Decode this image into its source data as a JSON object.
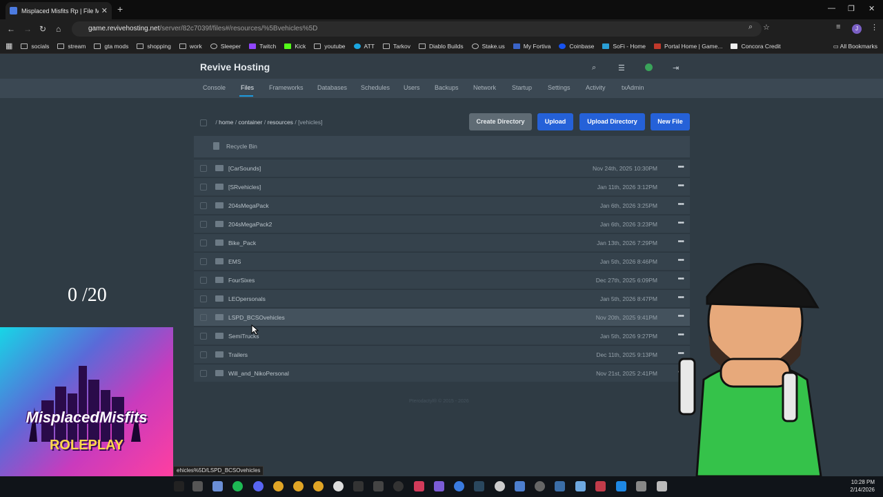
{
  "browser": {
    "tab_title": "Misplaced Misfits Rp | File Man...",
    "url_domain": "game.revivehosting.net",
    "url_path": "/server/82c7039f/files#/resources/%5Bvehicles%5D",
    "avatar_letter": "J",
    "bookmarks": [
      "socials",
      "stream",
      "gta mods",
      "shopping",
      "work",
      "Sleeper",
      "Twitch",
      "Kick",
      "youtube",
      "ATT",
      "Tarkov",
      "Diablo Builds",
      "Stake.us",
      "My Fortiva",
      "Coinbase",
      "SoFi - Home",
      "Portal Home | Game...",
      "Concora Credit"
    ],
    "all_bookmarks": "All Bookmarks"
  },
  "panel": {
    "brand": "Revive Hosting",
    "nav": [
      "Console",
      "Files",
      "Frameworks",
      "Databases",
      "Schedules",
      "Users",
      "Backups",
      "Network",
      "Startup",
      "Settings",
      "Activity",
      "txAdmin"
    ],
    "active_nav": "Files",
    "breadcrumb": {
      "sep": "/",
      "parts": [
        "home",
        "container",
        "resources"
      ],
      "current": "[vehicles]"
    },
    "buttons": {
      "create_directory": "Create Directory",
      "upload": "Upload",
      "upload_directory": "Upload Directory",
      "new_file": "New File"
    },
    "recycle_bin": "Recycle Bin",
    "files": [
      {
        "name": "[CarSounds]",
        "date": "Nov 24th, 2025 10:30PM"
      },
      {
        "name": "[SRvehicles]",
        "date": "Jan 11th, 2026 3:12PM"
      },
      {
        "name": "204sMegaPack",
        "date": "Jan 6th, 2026 3:25PM"
      },
      {
        "name": "204sMegaPack2",
        "date": "Jan 6th, 2026 3:23PM"
      },
      {
        "name": "Bike_Pack",
        "date": "Jan 13th, 2026 7:29PM"
      },
      {
        "name": "EMS",
        "date": "Jan 5th, 2026 8:46PM"
      },
      {
        "name": "FourSixes",
        "date": "Dec 27th, 2025 6:09PM"
      },
      {
        "name": "LEOpersonals",
        "date": "Jan 5th, 2026 8:47PM"
      },
      {
        "name": "LSPD_BCSOvehicles",
        "date": "Nov 20th, 2025 9:41PM"
      },
      {
        "name": "SemiTrucks",
        "date": "Jan 5th, 2026 9:27PM"
      },
      {
        "name": "Trailers",
        "date": "Dec 11th, 2025 9:13PM"
      },
      {
        "name": "Will_and_NikoPersonal",
        "date": "Nov 21st, 2025 2:41PM"
      }
    ],
    "footer": "Pterodactyl® © 2015 - 2026"
  },
  "overlay": {
    "counter": "0 /20",
    "logo_line1": "MisplacedMisfits",
    "logo_line2": "ROLEPLAY",
    "status_tooltip": "ehicles%5D/LSPD_BCSOvehicles"
  },
  "taskbar": {
    "time": "10:28 PM",
    "date": "2/14/2026"
  },
  "colors": {
    "accent_blue": "#2561d8",
    "tab_underline": "#1e9ce0",
    "panel_bg": "#2f3b44"
  }
}
